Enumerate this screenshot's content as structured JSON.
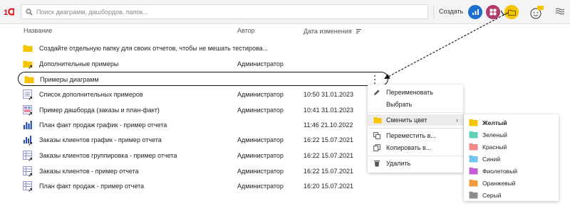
{
  "app": {
    "logo_text": "1С"
  },
  "search": {
    "placeholder": "Поиск диаграмм, дашбордов, папок..."
  },
  "toolbar": {
    "create_label": "Создать",
    "icons": [
      "bar-chart-icon",
      "dashboard-icon",
      "folder-icon",
      "user-avatar-icon",
      "menu-icon"
    ],
    "colors": {
      "blue": "#1a6fd0",
      "magenta": "#b03a6e",
      "yellow": "#f6c500"
    }
  },
  "table": {
    "columns": {
      "name": "Название",
      "author": "Автор",
      "date": "Дата изменения"
    },
    "rows": [
      {
        "type": "folder",
        "icon": "folder-icon",
        "name": "Создайте отдельную папку для своих отчетов, чтобы не мешать тестирова...",
        "author": "",
        "date": ""
      },
      {
        "type": "folder-link",
        "icon": "folder-link-icon",
        "name": "Дополнительные примеры",
        "author": "Администратор",
        "date": ""
      },
      {
        "type": "folder",
        "icon": "folder-icon",
        "name": "Примеры диаграмм",
        "author": "",
        "date": "",
        "selected": true
      },
      {
        "type": "report-link",
        "icon": "report-link-icon",
        "name": "Список дополнительных примеров",
        "author": "Администратор",
        "date": "10:50 31.01.2023"
      },
      {
        "type": "dashboard-link",
        "icon": "dashboard-link-icon",
        "name": "Пример дашборда (заказы и план-факт)",
        "author": "Администратор",
        "date": "10:41 31.01.2023"
      },
      {
        "type": "chart",
        "icon": "bar-chart-icon",
        "name": "План факт продаж график - пример отчета",
        "author": "",
        "date": "11:46 21.10.2022"
      },
      {
        "type": "chart-link",
        "icon": "bar-chart-link-icon",
        "name": "Заказы клиентов график - пример отчета",
        "author": "Администратор",
        "date": "16:22 15.07.2021"
      },
      {
        "type": "table-link",
        "icon": "table-link-icon",
        "name": "Заказы клиентов группировка - пример отчета",
        "author": "Администратор",
        "date": "16:22 15.07.2021"
      },
      {
        "type": "table-link",
        "icon": "table-link-icon",
        "name": "Заказы клиентов - пример отчета",
        "author": "Администратор",
        "date": "16:22 15.07.2021"
      },
      {
        "type": "table-link",
        "icon": "table-link-icon",
        "name": "План факт продаж - пример отчета",
        "author": "Администратор",
        "date": "16:20 15.07.2021"
      }
    ]
  },
  "context_menu": {
    "items": [
      {
        "icon": "pencil-icon",
        "label": "Переименовать"
      },
      {
        "icon": "",
        "label": "Выбрать"
      },
      {
        "icon": "folder-color-icon",
        "label": "Сменить цвет",
        "arrow": "›"
      },
      {
        "icon": "move-icon",
        "label": "Переместить в..."
      },
      {
        "icon": "copy-icon",
        "label": "Копировать в..."
      },
      {
        "icon": "trash-icon",
        "label": "Удалить"
      }
    ]
  },
  "color_submenu": {
    "items": [
      {
        "label": "Желтый",
        "color": "#f6c500"
      },
      {
        "label": "Зеленый",
        "color": "#5fd0b5"
      },
      {
        "label": "Красный",
        "color": "#f08a8a"
      },
      {
        "label": "Синий",
        "color": "#6fc6ef"
      },
      {
        "label": "Фиолетовый",
        "color": "#c35ed6"
      },
      {
        "label": "Оранжевый",
        "color": "#f39a3e"
      },
      {
        "label": "Серый",
        "color": "#8c8c8c"
      }
    ]
  }
}
